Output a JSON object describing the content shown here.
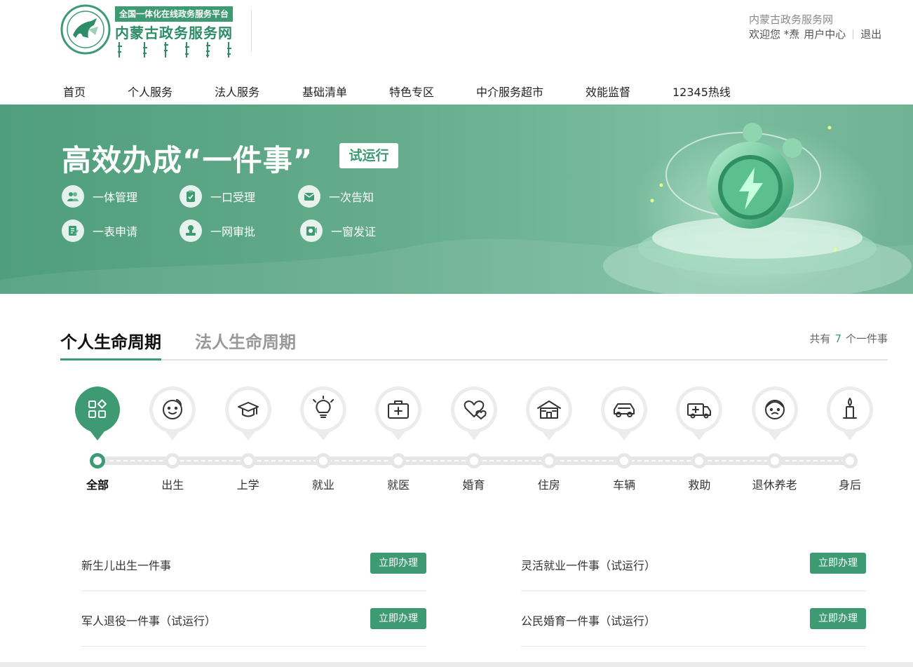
{
  "header": {
    "platform_tag": "全国一体化在线政务服务平台",
    "site_title": "内蒙古政务服务网",
    "user_site": "内蒙古政务服务网",
    "welcome": "欢迎您 *焘",
    "user_center": "用户中心",
    "logout": "退出"
  },
  "nav": {
    "items": [
      "首页",
      "个人服务",
      "法人服务",
      "基础清单",
      "特色专区",
      "中介服务超市",
      "效能监督",
      "12345热线"
    ]
  },
  "banner": {
    "title": "高效办成“一件事”",
    "badge": "试运行",
    "features": [
      "一体管理",
      "一口受理",
      "一次告知",
      "一表申请",
      "一网审批",
      "一窗发证"
    ]
  },
  "tabs": {
    "personal": "个人生命周期",
    "corporate": "法人生命周期",
    "count_prefix": "共有",
    "count": "7",
    "count_suffix": "个一件事"
  },
  "stages": {
    "items": [
      {
        "label": "全部",
        "icon": "grid-icon"
      },
      {
        "label": "出生",
        "icon": "baby-face-icon"
      },
      {
        "label": "上学",
        "icon": "graduation-cap-icon"
      },
      {
        "label": "就业",
        "icon": "lightbulb-icon"
      },
      {
        "label": "就医",
        "icon": "medical-kit-icon"
      },
      {
        "label": "婚育",
        "icon": "hearts-icon"
      },
      {
        "label": "住房",
        "icon": "house-icon"
      },
      {
        "label": "车辆",
        "icon": "car-icon"
      },
      {
        "label": "救助",
        "icon": "ambulance-icon"
      },
      {
        "label": "退休养老",
        "icon": "elder-face-icon"
      },
      {
        "label": "身后",
        "icon": "candle-icon"
      }
    ],
    "active_index": 0
  },
  "services": [
    {
      "title": "新生儿出生一件事",
      "action": "立即办理"
    },
    {
      "title": "灵活就业一件事（试运行）",
      "action": "立即办理"
    },
    {
      "title": "军人退役一件事（试运行）",
      "action": "立即办理"
    },
    {
      "title": "公民婚育一件事（试运行）",
      "action": "立即办理"
    }
  ],
  "colors": {
    "brand": "#3d9a73",
    "banner": "#63ab8b",
    "text": "#333333"
  }
}
